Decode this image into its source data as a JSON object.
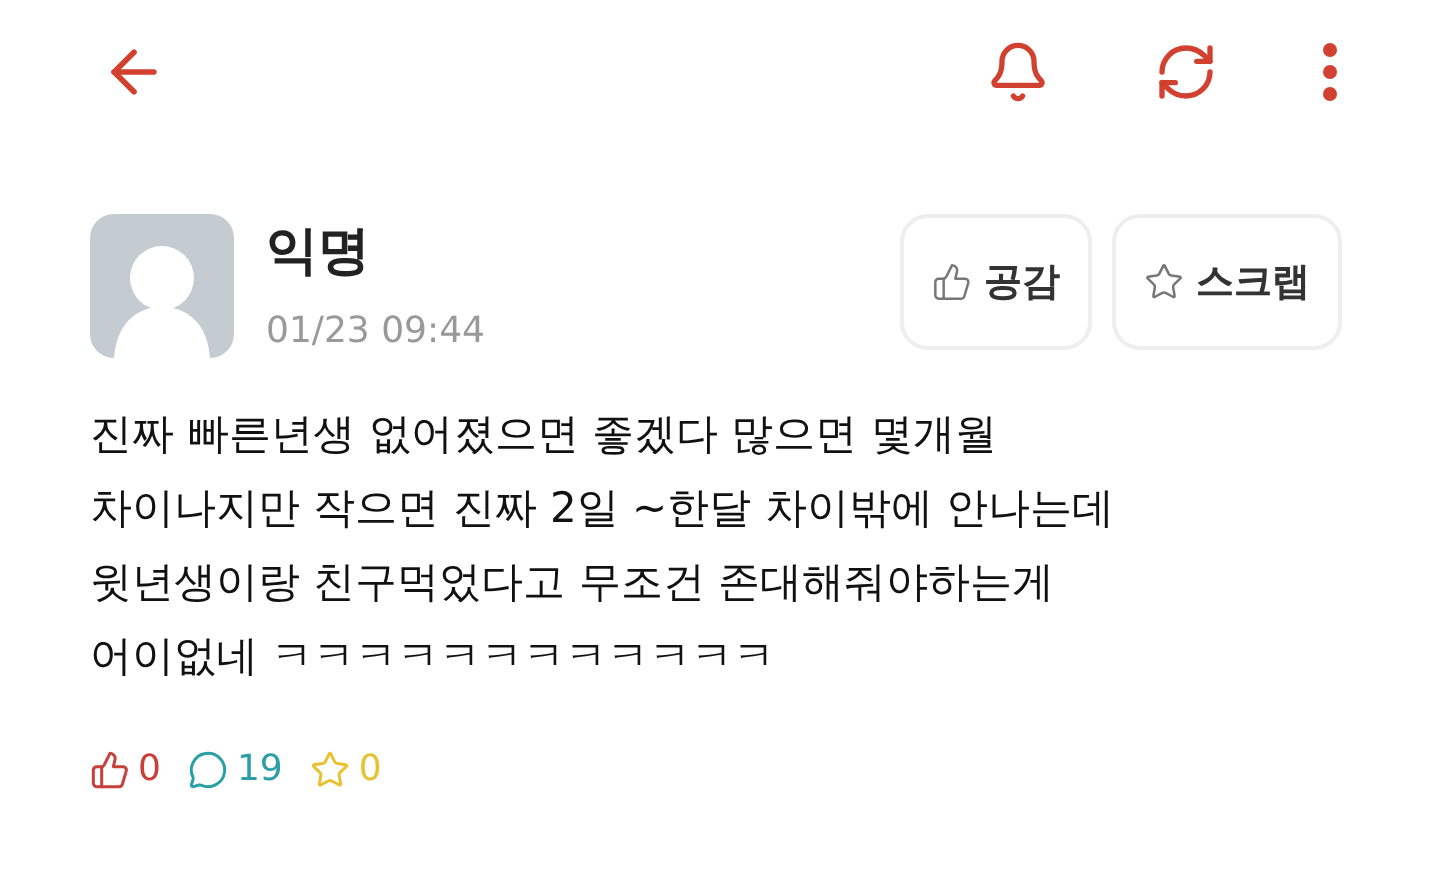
{
  "post": {
    "author": "익명",
    "time": "01/23 09:44",
    "actions": [
      {
        "kind": "like",
        "label": "공감"
      },
      {
        "kind": "scrap",
        "label": "스크랩"
      }
    ],
    "body": "진짜 빠른년생 없어졌으면 좋겠다 많으면 몇개월\n차이나지만 작으면 진짜 2일 ~한달 차이밖에 안나는데\n윗년생이랑 친구먹었다고 무조건 존대해줘야하는게\n어이없네 ㅋㅋㅋㅋㅋㅋㅋㅋㅋㅋㅋㅋ",
    "stats": [
      {
        "kind": "like",
        "count": "0",
        "color": "#c9403a"
      },
      {
        "kind": "comment",
        "count": "19",
        "color": "#2a9fa6"
      },
      {
        "kind": "scrap",
        "count": "0",
        "color": "#e8c233"
      }
    ]
  }
}
